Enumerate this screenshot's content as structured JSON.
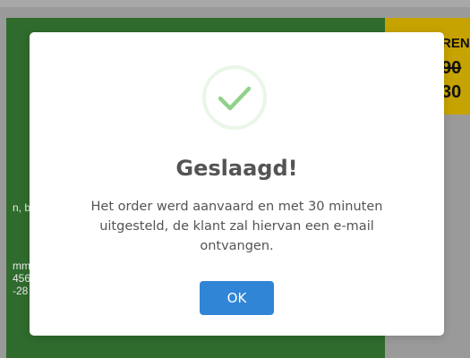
{
  "background": {
    "card_label": "REN",
    "old_price": "90",
    "new_price": "30",
    "text_fragments": [
      "n, b",
      "mm",
      "456",
      "-28"
    ]
  },
  "dialog": {
    "icon": "success-check-icon",
    "title": "Geslaagd!",
    "message": "Het order werd aanvaard en met 30 minuten uitgesteld, de klant zal hiervan een e-mail ontvangen.",
    "ok_label": "OK"
  },
  "colors": {
    "accent": "#3085d6",
    "success": "#8fd18a",
    "panel_green": "#2f6b2c",
    "card_yellow": "#c7a300"
  }
}
